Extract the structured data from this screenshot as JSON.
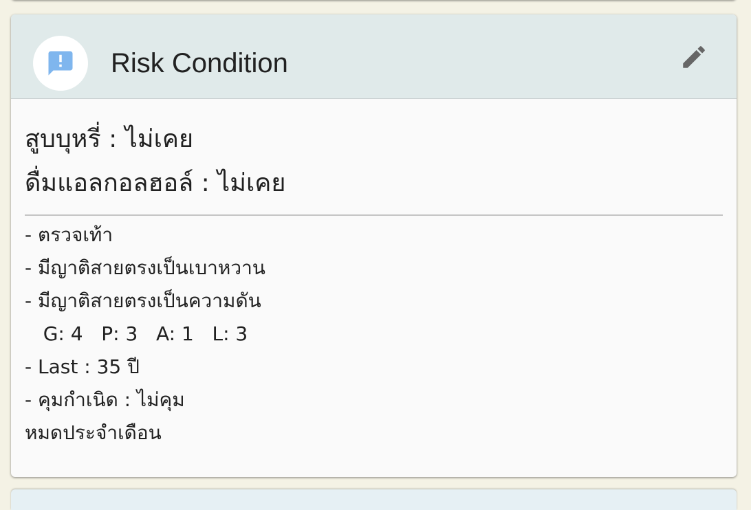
{
  "card": {
    "title": "Risk Condition",
    "header_icon": "feedback-alert-icon",
    "edit_icon": "pencil-edit-icon",
    "accent_color": "#7fb6ee",
    "header_bg": "#e0eaea"
  },
  "summary": [
    "สูบบุหรี่ : ไม่เคย",
    "ดื่มแอลกอลฮอล์ : ไม่เคย"
  ],
  "details": [
    "- ตรวจเท้า",
    "- มีญาติสายตรงเป็นเบาหวาน",
    "- มีญาติสายตรงเป็นความดัน",
    "   G: 4   P: 3   A: 1   L: 3",
    "- Last : 35 ปี",
    "- คุมกำเนิด : ไม่คุม",
    "หมดประจำเดือน"
  ]
}
